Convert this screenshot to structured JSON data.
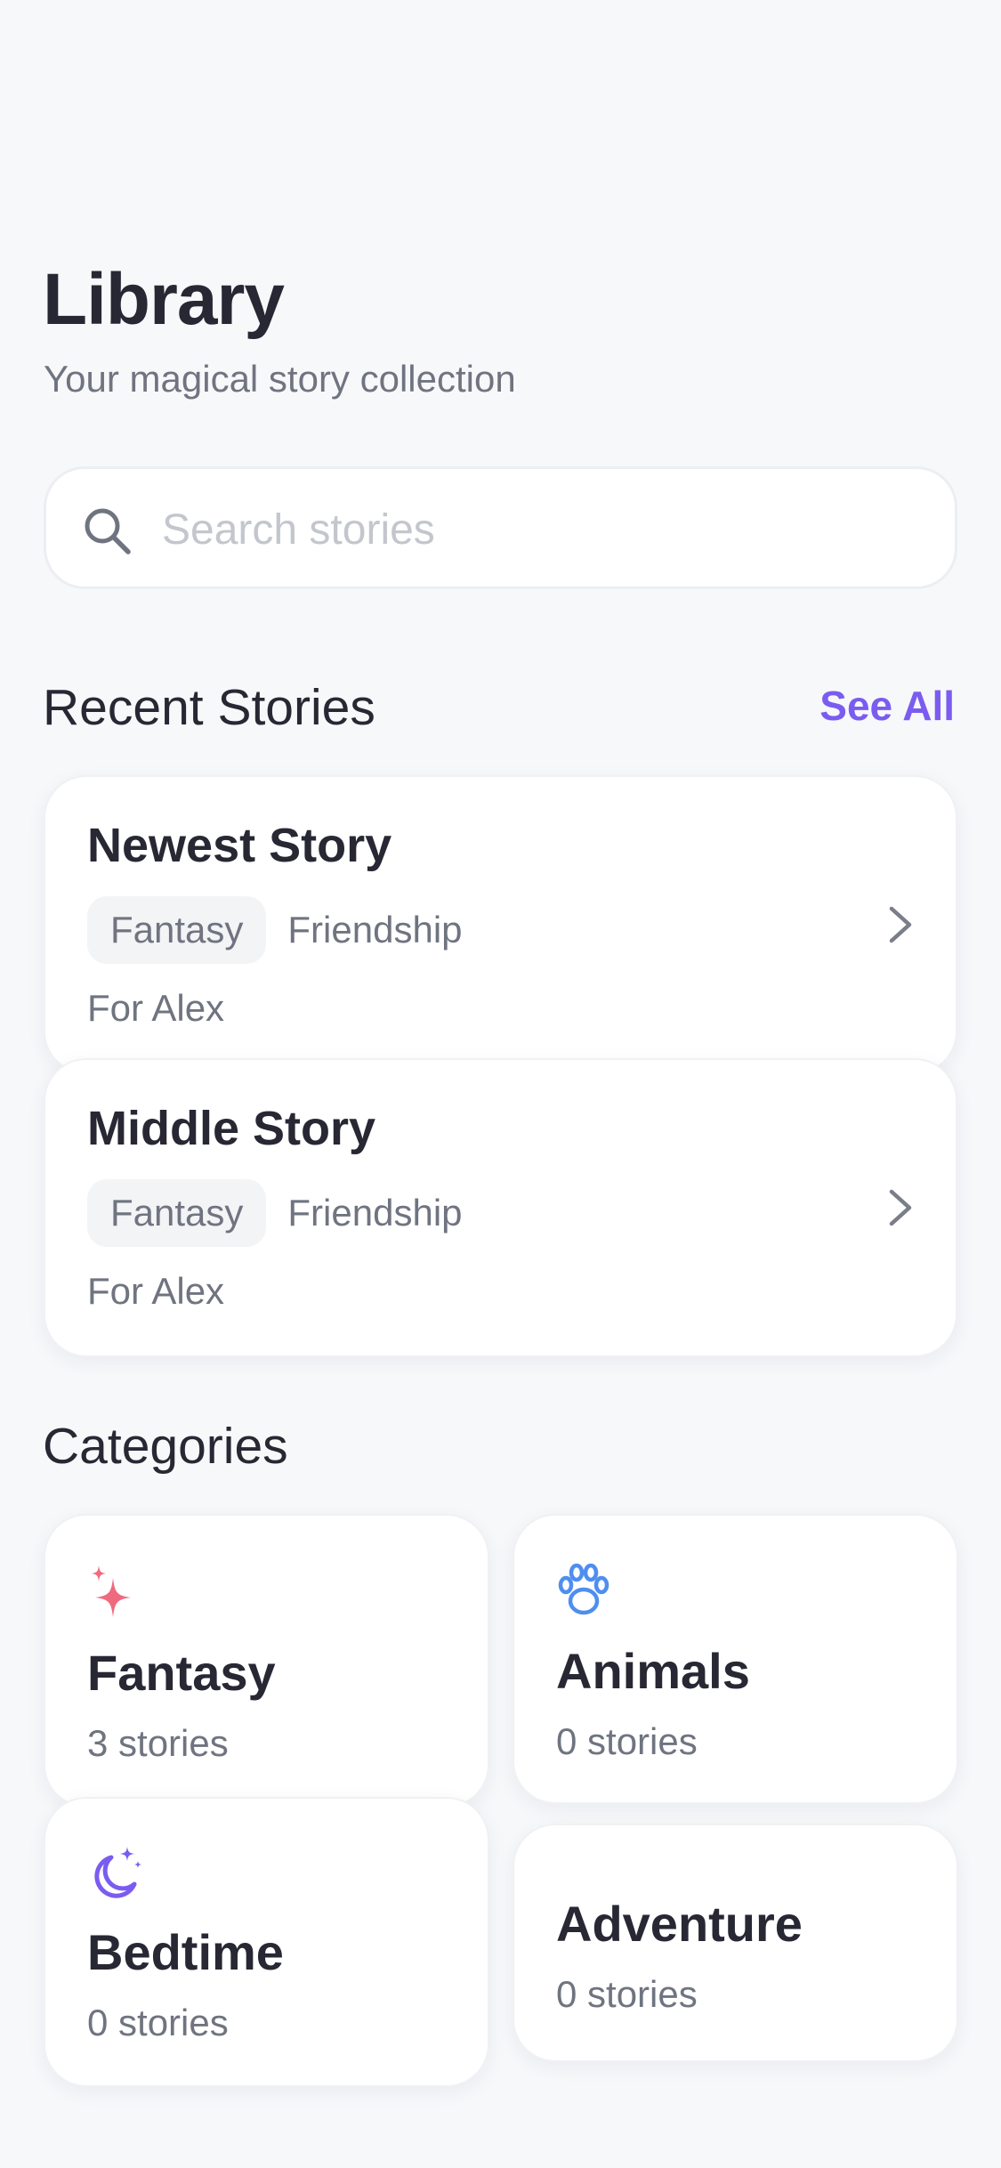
{
  "header": {
    "title": "Library",
    "subtitle": "Your magical story collection"
  },
  "search": {
    "placeholder": "Search stories",
    "value": "",
    "icon": "search-icon"
  },
  "recent": {
    "heading": "Recent Stories",
    "see_all_label": "See All",
    "stories": [
      {
        "title": "Newest Story",
        "tags": [
          "Fantasy",
          "Friendship"
        ],
        "audience": "For Alex"
      },
      {
        "title": "Middle Story",
        "tags": [
          "Fantasy",
          "Friendship"
        ],
        "audience": "For Alex"
      }
    ]
  },
  "categories": {
    "heading": "Categories",
    "items": [
      {
        "name": "Fantasy",
        "count": "3 stories",
        "icon": "sparkles-icon",
        "color": "#f06a7e"
      },
      {
        "name": "Animals",
        "count": "0 stories",
        "icon": "paw-icon",
        "color": "#4f8ef0"
      },
      {
        "name": "Bedtime",
        "count": "0 stories",
        "icon": "moon-stars-icon",
        "color": "#7b5cf0"
      },
      {
        "name": "Adventure",
        "count": "0 stories",
        "icon": "",
        "color": ""
      }
    ]
  },
  "colors": {
    "accent": "#7b5cf0",
    "background": "#f7f8fa",
    "text_primary": "#272833",
    "text_secondary": "#6f7480"
  }
}
